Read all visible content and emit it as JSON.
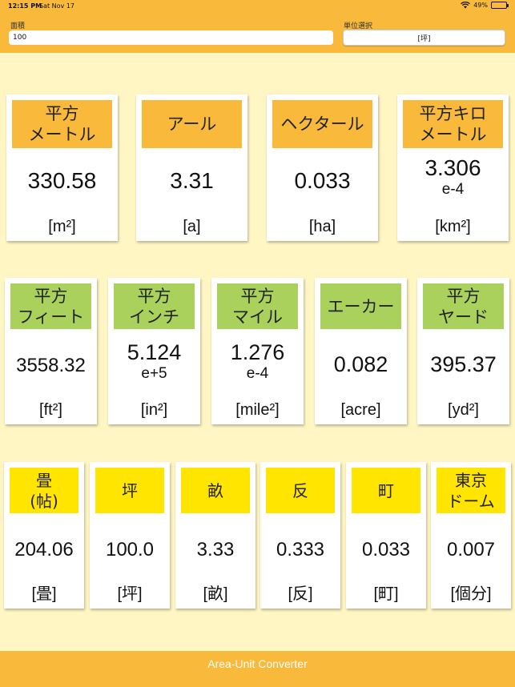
{
  "status_bar": {
    "time": "12:15 PM",
    "date": "Sat Nov 17",
    "battery": "49%",
    "battery_level": 0.49
  },
  "input_area": {
    "label": "面積",
    "value": "100"
  },
  "unit_select": {
    "label": "単位選択",
    "value": "[坪]"
  },
  "colors": {
    "header": "#f9b93b",
    "background": "#fff6c4",
    "group1": "#f9b93b",
    "group2": "#a9d15b",
    "group3": "#ffe500"
  },
  "cards": [
    {
      "title": "平方\nメートル",
      "value": "330.58",
      "value_sub": "",
      "unit": "[m²]"
    },
    {
      "title": "アール",
      "value": "3.31",
      "value_sub": "",
      "unit": "[a]"
    },
    {
      "title": "ヘクタール",
      "value": "0.033",
      "value_sub": "",
      "unit": "[ha]"
    },
    {
      "title": "平方キロ\nメートル",
      "value": "3.306",
      "value_sub": "e-4",
      "unit": "[km²]"
    },
    {
      "title": "平方\nフィート",
      "value": "3558.32",
      "value_sub": "",
      "unit": "[ft²]"
    },
    {
      "title": "平方\nインチ",
      "value": "5.124",
      "value_sub": "e+5",
      "unit": "[in²]"
    },
    {
      "title": "平方\nマイル",
      "value": "1.276",
      "value_sub": "e-4",
      "unit": "[mile²]"
    },
    {
      "title": "エーカー",
      "value": "0.082",
      "value_sub": "",
      "unit": "[acre]"
    },
    {
      "title": "平方\nヤード",
      "value": "395.37",
      "value_sub": "",
      "unit": "[yd²]"
    },
    {
      "title": "畳\n(帖)",
      "value": "204.06",
      "value_sub": "",
      "unit": "[畳]"
    },
    {
      "title": "坪",
      "value": "100.0",
      "value_sub": "",
      "unit": "[坪]"
    },
    {
      "title": "畝",
      "value": "3.33",
      "value_sub": "",
      "unit": "[畝]"
    },
    {
      "title": "反",
      "value": "0.333",
      "value_sub": "",
      "unit": "[反]"
    },
    {
      "title": "町",
      "value": "0.033",
      "value_sub": "",
      "unit": "[町]"
    },
    {
      "title": "東京\nドーム",
      "value": "0.007",
      "value_sub": "",
      "unit": "[個分]"
    }
  ],
  "footer": {
    "title": "Area-Unit Converter"
  }
}
